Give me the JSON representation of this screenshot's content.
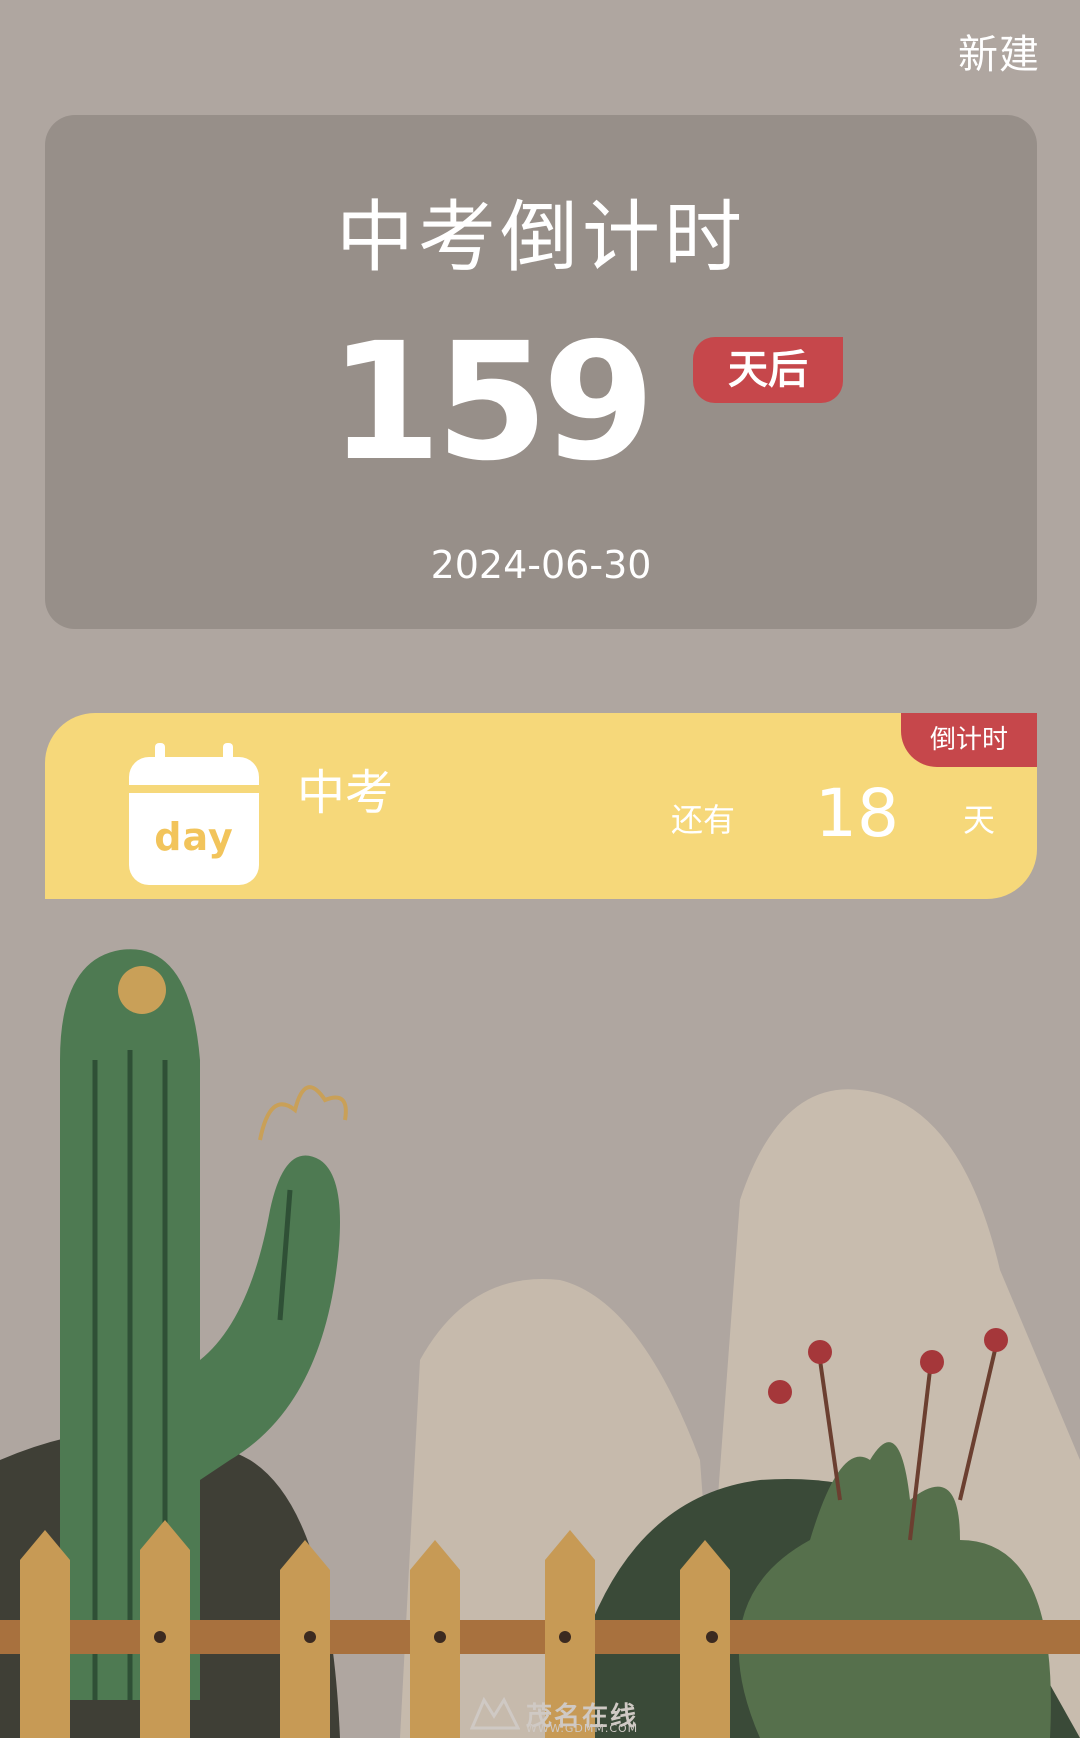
{
  "header": {
    "new_label": "新建"
  },
  "hero": {
    "title": "中考倒计时",
    "days": "159",
    "badge": "天后",
    "date": "2024-06-30"
  },
  "event": {
    "icon_text": "day",
    "title": "中考",
    "prefix": "还有",
    "count": "18",
    "unit": "天",
    "tag": "倒计时"
  },
  "watermark": {
    "text": "茂名在线",
    "sub": "WWW.GDMM.COM"
  },
  "colors": {
    "background": "#afa6a0",
    "hero_card": "#978f89",
    "badge_red": "#c6474b",
    "event_yellow": "#f6d87a"
  }
}
